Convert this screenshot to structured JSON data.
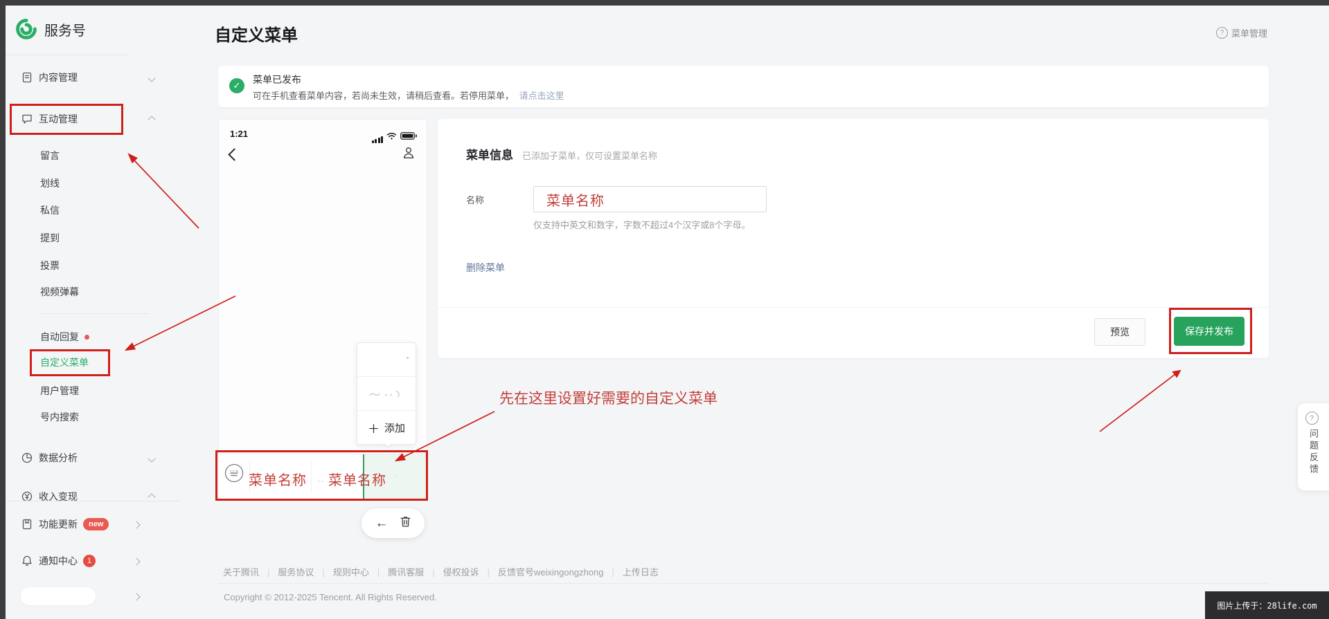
{
  "header": {
    "title": "自定义菜单",
    "help_label": "菜单管理"
  },
  "sidebar": {
    "brand": "服务号",
    "top_items": [
      "内容管理",
      "互动管理",
      "数据分析",
      "收入变现",
      "功能更新",
      "通知中心"
    ],
    "sub_items": [
      "留言",
      "划线",
      "私信",
      "提到",
      "投票",
      "视频弹幕",
      "自动回复",
      "自定义菜单",
      "用户管理",
      "号内搜索"
    ],
    "new_badge": "new",
    "notice_count": "1"
  },
  "banner": {
    "status_title": "菜单已发布",
    "status_desc": "可在手机查看菜单内容，若尚未生效，请稍后查看。若停用菜单，",
    "status_link": "请点击这里"
  },
  "phone": {
    "status_time": "1:21",
    "popup_add_label": "添加",
    "menu_item_left": "菜单名称",
    "menu_item_right": "菜单名称"
  },
  "form": {
    "section_title": "菜单信息",
    "section_hint": "已添加子菜单，仅可设置菜单名称",
    "name_label": "名称",
    "name_value": "菜单名称",
    "name_helper": "仅支持中英文和数字，字数不超过4个汉字或8个字母。",
    "delete_label": "删除菜单",
    "preview_label": "预览",
    "save_label": "保存并发布"
  },
  "annotations": {
    "tip": "先在这里设置好需要的自定义菜单",
    "box_color": "#ce1f1b",
    "text_color": "#c2403a"
  },
  "feedback": {
    "label": "问题反馈"
  },
  "footer": {
    "links": [
      "关于腾讯",
      "服务协议",
      "规则中心",
      "腾讯客服",
      "侵权投诉",
      "反馈官号weixingongzhong",
      "上传日志"
    ],
    "copyright": "Copyright © 2012-2025 Tencent. All Rights Reserved."
  },
  "watermark": {
    "text": "图片上传于：28life.com"
  },
  "colors": {
    "brand_green": "#2aae67",
    "save_green": "#27a35d",
    "annotation_red": "#ce1f1b",
    "badge_red": "#e8594f",
    "link_blue": "#62779c",
    "muted_link": "#97a6bd"
  }
}
